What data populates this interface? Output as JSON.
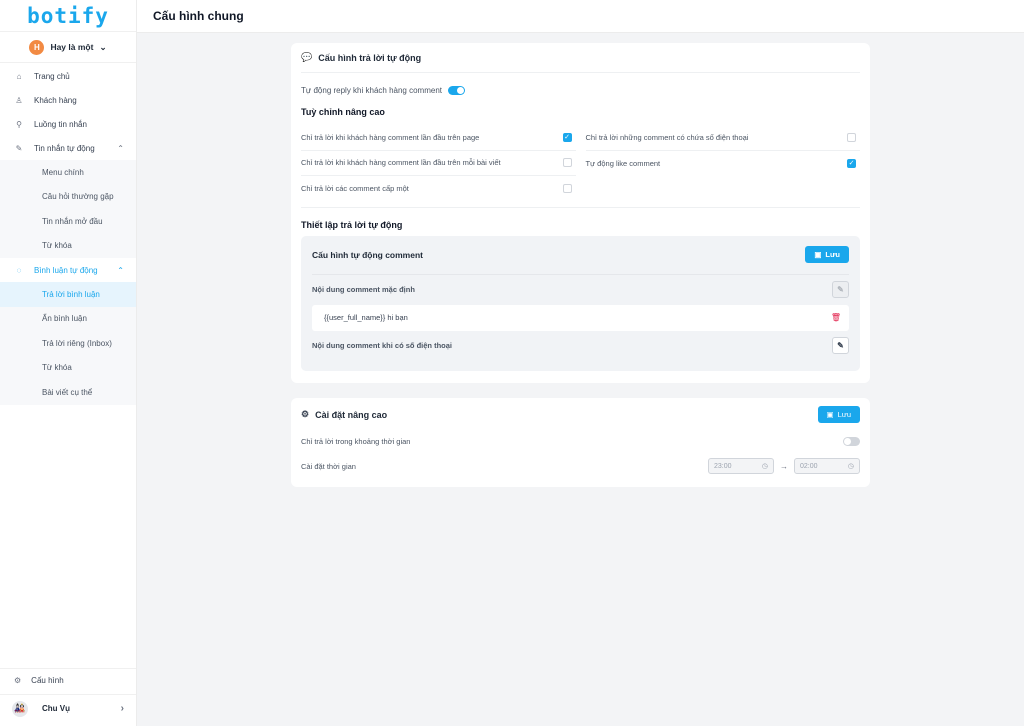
{
  "app": {
    "logo": "botify",
    "page_title": "Cấu hình chung"
  },
  "workspace": {
    "initial": "H",
    "name": "Hay là một"
  },
  "nav": {
    "items": [
      {
        "label": "Trang chủ",
        "icon": "⌂"
      },
      {
        "label": "Khách hàng",
        "icon": "♙"
      },
      {
        "label": "Luồng tin nhắn",
        "icon": "⚲"
      }
    ],
    "auto_message": {
      "label": "Tin nhắn tự động",
      "icon": "✎",
      "children": [
        "Menu chính",
        "Câu hỏi thường gặp",
        "Tin nhắn mở đầu",
        "Từ khóa"
      ]
    },
    "auto_comment": {
      "label": "Bình luận tự động",
      "icon": "◌",
      "children": [
        "Trả lời bình luận",
        "Ẩn bình luận",
        "Trả lời riêng (Inbox)",
        "Từ khóa",
        "Bài viết cụ thể"
      ],
      "active_index": 0
    }
  },
  "sidebar_bottom": {
    "settings_label": "Cấu hình",
    "user_name": "Chu Vụ",
    "user_avatar": "🎎"
  },
  "auto_reply": {
    "title": "Cấu hình trả lời tự động",
    "toggle_label": "Tự động reply khi khách hàng comment",
    "toggle_on": true,
    "advanced_title": "Tuỳ chỉnh nâng cao",
    "options_left": [
      {
        "label": "Chỉ trả lời khi khách hàng comment lần đầu trên page",
        "checked": true
      },
      {
        "label": "Chỉ trả lời khi khách hàng comment lần đầu trên mỗi bài viết",
        "checked": false
      },
      {
        "label": "Chỉ trả lời các comment cấp một",
        "checked": false
      }
    ],
    "options_right": [
      {
        "label": "Chỉ trả lời những comment có chứa số điện thoại",
        "checked": false
      },
      {
        "label": "Tự động like comment",
        "checked": true
      }
    ],
    "setup_title": "Thiết lập trả lời tự động",
    "comment_config": {
      "title": "Cấu hình tự động comment",
      "save_label": "Lưu",
      "default_label": "Nội dung comment mặc định",
      "default_value": "{{user_full_name}} hi bạn",
      "phone_label": "Nội dung comment khi có số điện thoại"
    }
  },
  "advanced": {
    "title": "Cài đặt nâng cao",
    "save_label": "Lưu",
    "time_only_label": "Chỉ trả lời trong khoảng thời gian",
    "time_only_on": false,
    "time_setting_label": "Cài đặt thời gian",
    "time_from": "23:00",
    "time_to": "02:00"
  },
  "colors": {
    "accent": "#1aa7ec",
    "danger": "#e11d48",
    "avatar": "#f28a43"
  }
}
